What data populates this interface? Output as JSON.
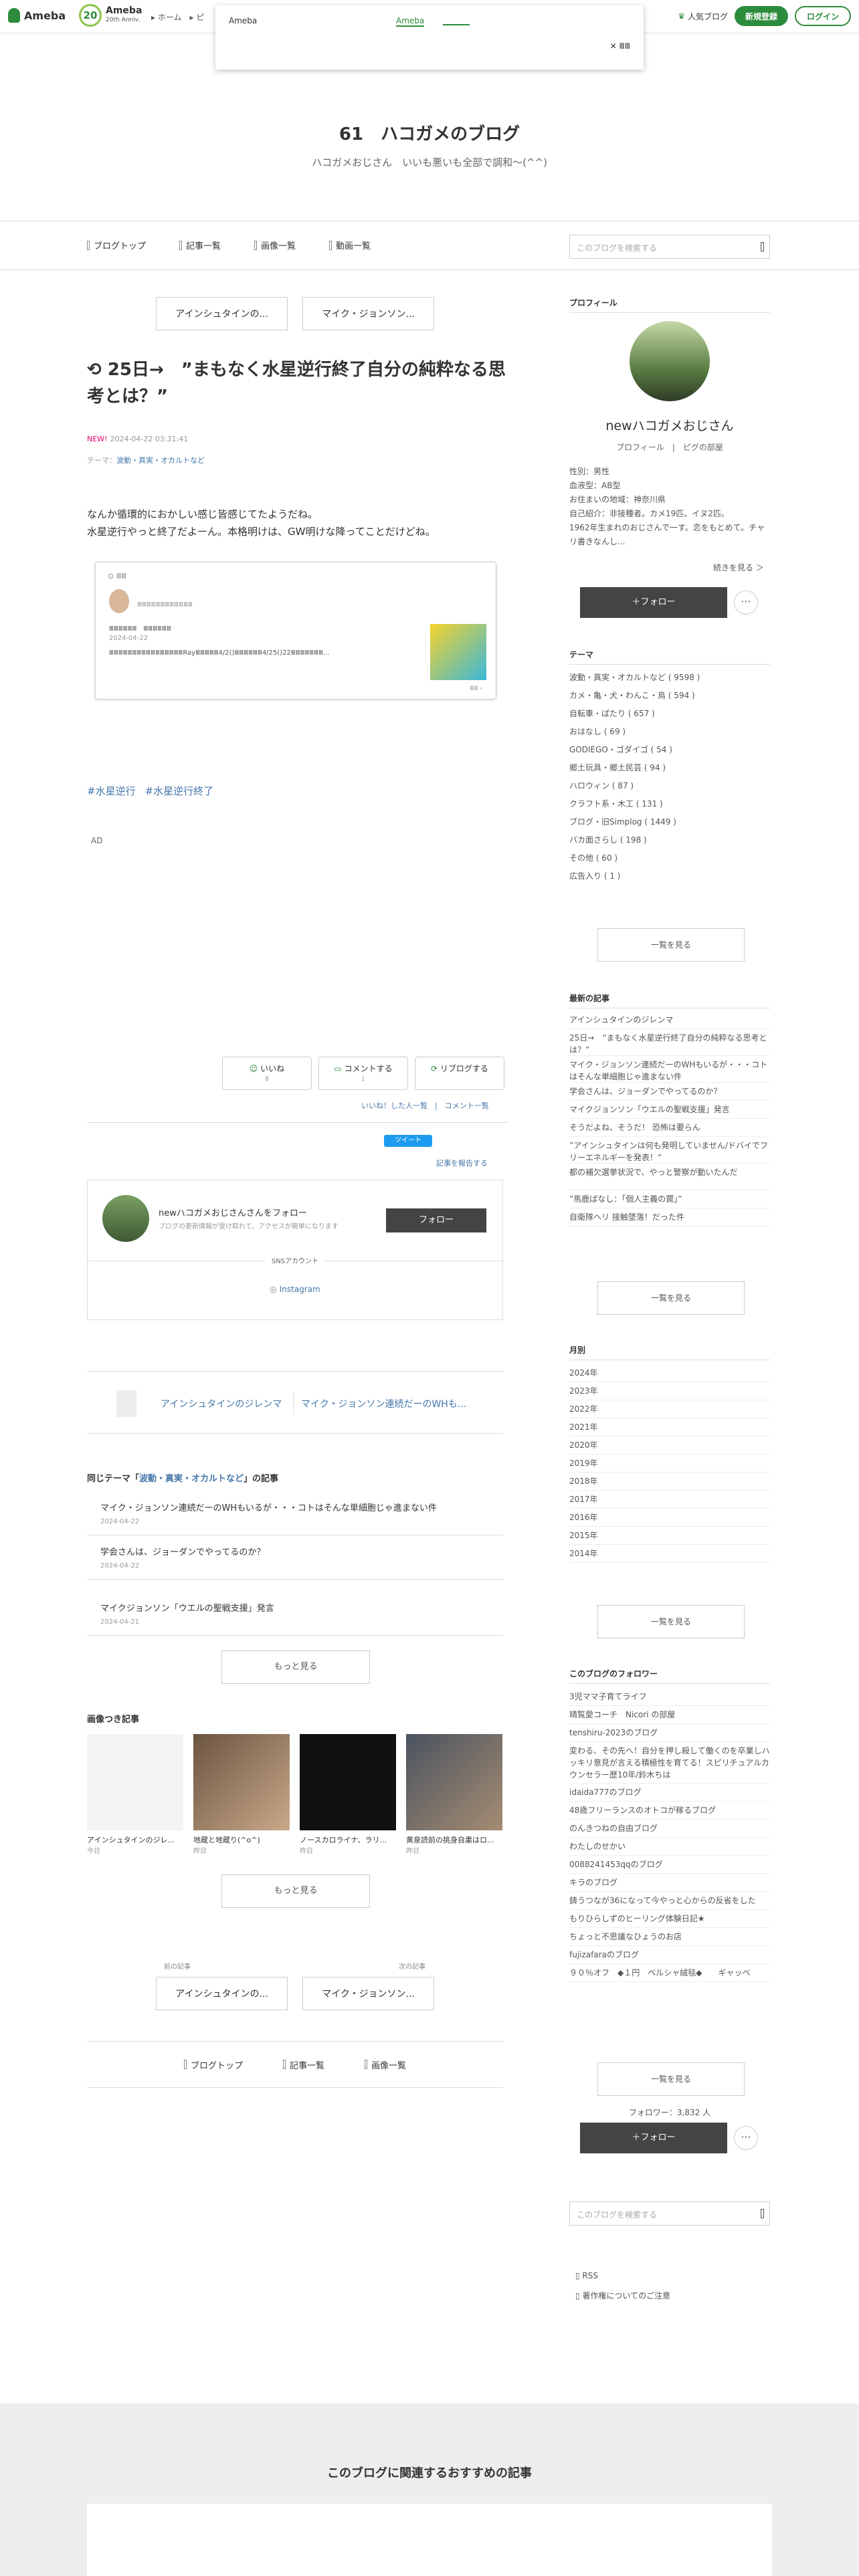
{
  "header": {
    "logo": "Ameba",
    "anniv_num": "20",
    "anniv_title": "Ameba",
    "anniv_sub": "20th Anniv.",
    "nav": "▸ ホーム　▸ ピ",
    "popular": "人気ブログ",
    "register": "新規登録",
    "login": "ログイン"
  },
  "popup": {
    "left": "Ameba",
    "right": "Ameba",
    "close": "✕ ⅢⅢ"
  },
  "blog": {
    "title": "61　ハコガメのブログ",
    "subtitle": "ハコガメおじさん　いいも悪いも全部で調和〜(^^)"
  },
  "blognav": {
    "items": [
      "ブログトップ",
      "記事一覧",
      "画像一覧",
      "動画一覧"
    ],
    "search_placeholder": "このブログを検索する"
  },
  "pager": {
    "prev": "アインシュタインの...",
    "next": "マイク・ジョンソン..."
  },
  "entry": {
    "title": "25日→　”まもなく水星逆行終了自分の純粋なる思考とは？”",
    "new": "NEW!",
    "date": "2024-04-22 03:31:41",
    "theme_label": "テーマ：",
    "theme": "波動・真実・オカルトなど",
    "body1": "なんか循環的におかしい感じ皆感じてたようだね。",
    "body2": "水星逆行やっと終了だよーん。本格明けは、GW明けな降ってことだけどね。"
  },
  "card": {
    "top": "⊙ ⅢⅢ",
    "name": "ⅢⅢⅢⅢⅢⅢⅢⅢⅢⅢⅢⅢ",
    "title": "ⅢⅢⅢⅢⅢⅢ　ⅢⅢⅢⅢⅢⅢ",
    "date": "2024-04-22",
    "text": "ⅢⅢⅢⅢⅢⅢⅢⅢⅢⅢⅢⅢⅢⅢⅢⅢRayⅢⅢⅢⅢⅢ4/2()ⅢⅢⅢⅢⅢⅢ4/25()22ⅢⅢⅢⅢⅢⅢⅢ...",
    "more": "ⅢⅢ ›"
  },
  "tags": [
    "#水星逆行",
    "#水星逆行終了"
  ],
  "ad": "AD",
  "actions": {
    "like": "いいね",
    "like_count": "8",
    "comment": "コメントする",
    "comment_count": "1",
    "reblog": "リブログする",
    "likes_link": "いいね！した人一覧　|　コメント一覧",
    "tweet": "ツイート",
    "report": "記事を報告する"
  },
  "follow": {
    "name": "newハコガメおじさんさんをフォロー",
    "desc": "ブログの更新情報が受け取れて、アクセスが簡単になります",
    "button": "フォロー",
    "sns": "SNSアカウント",
    "instagram": "Instagram"
  },
  "pager2": {
    "prev": "アインシュタインのジレンマ",
    "next": "マイク・ジョンソン連続だーのWHも..."
  },
  "related": {
    "prefix": "同じテーマ「",
    "theme": "波動・真実・オカルトなど",
    "suffix": "」の記事",
    "items": [
      {
        "t": "マイク・ジョンソン連続だーのWHもいるが・・・コトはそんな単細胞じゃ進まない件",
        "d": "2024-04-22"
      },
      {
        "t": "学会さんは、ジョーダンでやってるのか？",
        "d": "2024-04-22"
      },
      {
        "t": "マイクジョンソン「ウエルの聖戦支援」発言",
        "d": "2024-04-21"
      }
    ],
    "more": "もっと見る"
  },
  "images": {
    "title": "画像つき記事",
    "items": [
      {
        "t": "アインシュタインのジレ...",
        "d": "今日"
      },
      {
        "t": "地蔵と地蔵り(^o^)",
        "d": "昨日"
      },
      {
        "t": "ノースカロライナ、ラリ...",
        "d": "昨日"
      },
      {
        "t": "黄泉読前の挑身自粛はロ...",
        "d": "昨日"
      }
    ],
    "more": "もっと見る"
  },
  "pager3": {
    "prev_label": "前の記事",
    "next_label": "次の記事",
    "prev": "アインシュタインの...",
    "next": "マイク・ジョンソン..."
  },
  "bottomnav": [
    "ブログトップ",
    "記事一覧",
    "画像一覧"
  ],
  "profile": {
    "heading": "プロフィール",
    "name": "newハコガメおじさん",
    "links": "プロフィール　|　ピグの部屋",
    "info": [
      "性別：男性",
      "血液型：AB型",
      "お住まいの地域：神奈川県",
      "自己紹介：非接種者。カメ19匹、イヌ2匹。",
      "1962年生まれのおじさんで一す。恋をもとめて。チャリ書きなんし..."
    ],
    "more": "続きを見る ＞",
    "follow": "＋フォロー",
    "dots": "···"
  },
  "themes": {
    "heading": "テーマ",
    "items": [
      "波動・真実・オカルトなど ( 9598 )",
      "カメ・亀・犬・わんこ・鳥 ( 594 )",
      "自転車・ぱたり ( 657 )",
      "おはなし ( 69 )",
      "GODIEGO・ゴダイゴ ( 54 )",
      "郷土玩具・郷土民芸 ( 94 )",
      "ハロウィン ( 87 )",
      "クラフト系・木工 ( 131 )",
      "ブログ・旧Simplog ( 1449 )",
      "バカ面さらし ( 198 )",
      "その他 ( 60 )",
      "広告入り ( 1 )"
    ],
    "more": "一覧を見る"
  },
  "latest": {
    "heading": "最新の記事",
    "items": [
      "アインシュタインのジレンマ",
      "25日→　”まもなく水星逆行終了自分の純粋なる思考とは？”",
      "マイク・ジョンソン連続だーのWHもいるが・・・コトはそんな単細胞じゃ進まない件",
      "学会さんは、ジョーダンでやってるのか？",
      "マイクジョンソン「ウエルの聖戦支援」発言",
      "そうだよね、そうだ！ 恐怖は要らん",
      "”アインシュタインは何も発明していません/ドバイでフリーエネルギーを発表！”",
      "都の補欠選挙状況で、やっと警察が動いたんだ",
      "”馬鹿ばなし：「個人主義の罠」”",
      "自衛隊ヘリ 接触墜落！だった件"
    ],
    "more": "一覧を見る"
  },
  "monthly": {
    "heading": "月別",
    "items": [
      "2024年",
      "2023年",
      "2022年",
      "2021年",
      "2020年",
      "2019年",
      "2018年",
      "2017年",
      "2016年",
      "2015年",
      "2014年"
    ],
    "more": "一覧を見る"
  },
  "followers": {
    "heading": "このブログのフォロワー",
    "items": [
      "3児ママ子育てライフ",
      "晴覧愛コーチ　Nicori の部屋",
      "tenshiru-2023のブログ",
      "変わる、その先へ！自分を押し殺して働くのを卒業しハッキリ意見が言える積極性を育てる！スピリチュアルカウンセラー歴10年/鈴木ちは",
      "idaida777のブログ",
      "48歳フリーランスのオトコが稼るブログ",
      "のんきつねの自由ブログ",
      "わたしのせかい",
      "0088241453qqのブログ",
      "キラのブログ",
      "鋳うつなが36になって今やっと心からの反省をした",
      "もりひらしずのヒーリング体験日記★",
      "ちょっと不思議なひょうのお店",
      "fujizafaraのブログ",
      "９０％オフ　◆１円　ベルシャ絨毯◆　　ギャッベ"
    ],
    "more": "一覧を見る",
    "count": "フォロワー：3,832 人",
    "follow": "＋フォロー",
    "dots": "···"
  },
  "sidesearch": "このブログを検索する",
  "footer": {
    "rss": "RSS",
    "copyright": "著作権についてのご注意"
  },
  "recommend": "このブログに関連するおすすめの記事",
  "colors": {
    "green": "#2d8c3c",
    "link": "#4477aa",
    "dark": "#444444"
  }
}
